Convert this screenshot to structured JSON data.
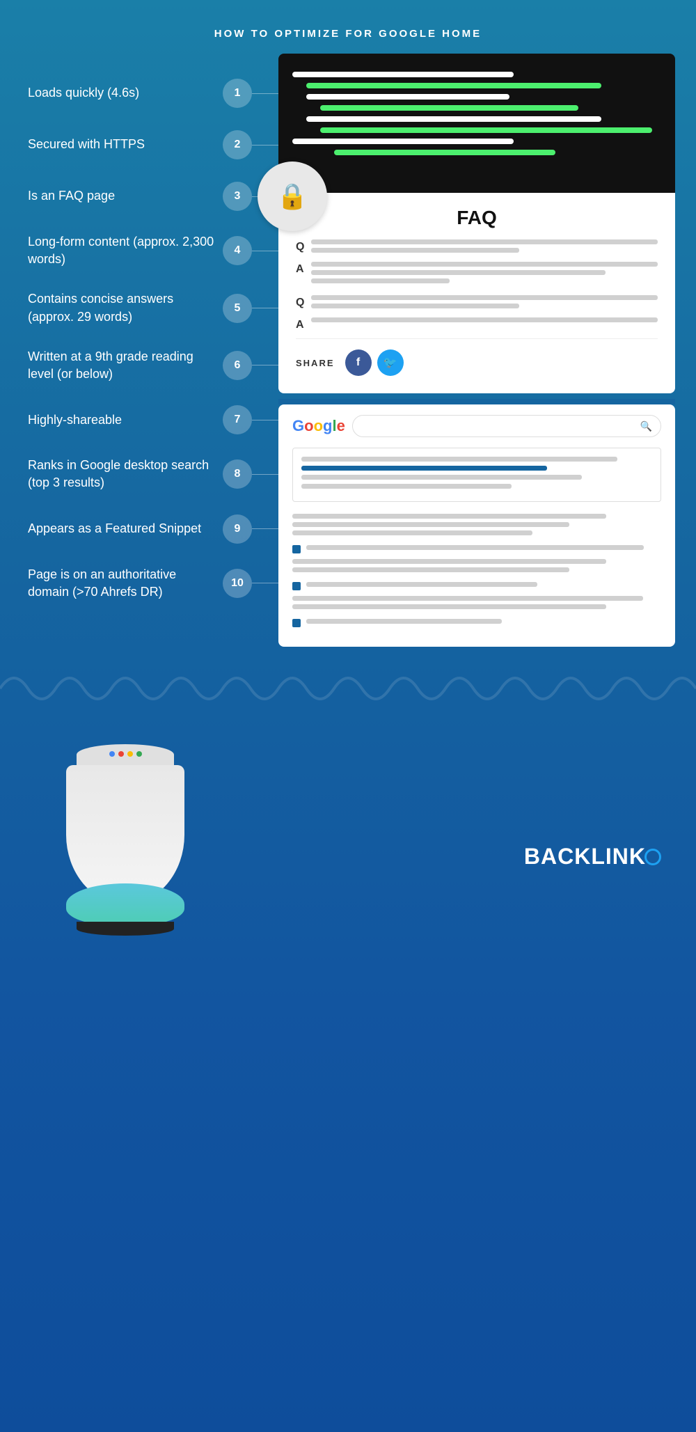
{
  "page": {
    "title": "HOW TO OPTIMIZE FOR GOOGLE HOME",
    "background_top": "#1a7fa8",
    "background_bottom": "#0e4d9b"
  },
  "items": [
    {
      "number": "1",
      "text": "Loads quickly (4.6s)"
    },
    {
      "number": "2",
      "text": "Secured with HTTPS"
    },
    {
      "number": "3",
      "text": "Is an FAQ page"
    },
    {
      "number": "4",
      "text": "Long-form content (approx. 2,300 words)"
    },
    {
      "number": "5",
      "text": "Contains concise answers (approx. 29 words)"
    },
    {
      "number": "6",
      "text": "Written at a 9th grade reading level (or below)"
    },
    {
      "number": "7",
      "text": "Highly-shareable"
    },
    {
      "number": "8",
      "text": "Ranks in Google desktop search (top 3 results)"
    },
    {
      "number": "9",
      "text": "Appears as a Featured Snippet"
    },
    {
      "number": "10",
      "text": "Page is on an authoritative domain (>70 Ahrefs DR)"
    }
  ],
  "faq_card": {
    "title": "FAQ"
  },
  "share_section": {
    "label": "SHARE"
  },
  "google_logo": {
    "G": "G",
    "o1": "o",
    "o2": "o",
    "g": "g",
    "l": "l",
    "e": "e"
  },
  "branding": {
    "name": "BACKLINK",
    "o": "O"
  }
}
